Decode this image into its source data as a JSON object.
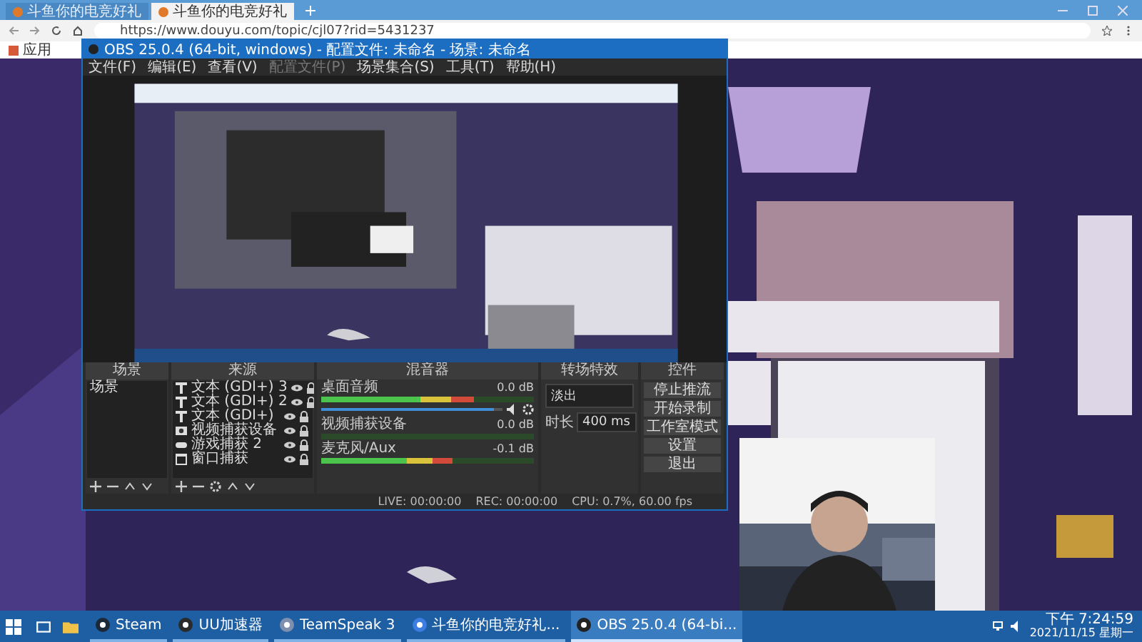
{
  "browser": {
    "tabs": [
      {
        "title": "斗鱼你的电竞好礼",
        "selected": false
      },
      {
        "title": "斗鱼你的电竞好礼",
        "selected": true
      }
    ],
    "url": "https://www.douyu.com/topic/cjl07?rid=5431237",
    "bookmarks": [
      "应用"
    ]
  },
  "obs": {
    "title": "OBS 25.0.4 (64-bit, windows) - 配置文件: 未命名 - 场景: 未命名",
    "menu": [
      {
        "label": "文件(F)",
        "disabled": false
      },
      {
        "label": "编辑(E)",
        "disabled": false
      },
      {
        "label": "查看(V)",
        "disabled": false
      },
      {
        "label": "配置文件(P)",
        "disabled": true
      },
      {
        "label": "场景集合(S)",
        "disabled": false
      },
      {
        "label": "工具(T)",
        "disabled": false
      },
      {
        "label": "帮助(H)",
        "disabled": false
      }
    ],
    "scenes": {
      "title": "场景",
      "items": [
        "场景"
      ]
    },
    "sources": {
      "title": "来源",
      "items": [
        {
          "label": "文本 (GDI+) 3",
          "kind": "text"
        },
        {
          "label": "文本 (GDI+) 2",
          "kind": "text"
        },
        {
          "label": "文本 (GDI+)",
          "kind": "text"
        },
        {
          "label": "视频捕获设备",
          "kind": "camera"
        },
        {
          "label": "游戏捕获 2",
          "kind": "game"
        },
        {
          "label": "窗口捕获",
          "kind": "window"
        }
      ]
    },
    "mixer": {
      "title": "混音器",
      "channels": [
        {
          "name": "桌面音频",
          "reading": "0.0 dB",
          "level": 0.72,
          "volume": {
            "level": 0.95
          }
        },
        {
          "name": "视频捕获设备",
          "reading": "0.0 dB",
          "level": 0.0
        },
        {
          "name": "麦克风/Aux",
          "reading": "-0.1 dB",
          "level": 0.62
        }
      ]
    },
    "transitions": {
      "title": "转场特效",
      "transition": "淡出",
      "duration_label": "时长",
      "duration": "400 ms"
    },
    "controls": {
      "title": "控件",
      "buttons": [
        "停止推流",
        "开始录制",
        "工作室模式",
        "设置",
        "退出"
      ]
    },
    "status": {
      "live": "LIVE: 00:00:00",
      "rec": "REC: 00:00:00",
      "cpu": "CPU: 0.7%, 60.00 fps"
    }
  },
  "taskbar": {
    "items": [
      {
        "label": "Steam",
        "kind": "steam",
        "selected": false
      },
      {
        "label": "UU加速器",
        "kind": "uu",
        "selected": false
      },
      {
        "label": "TeamSpeak 3",
        "kind": "teamspeak",
        "selected": false
      },
      {
        "label": "斗鱼你的电竞好礼...",
        "kind": "browser",
        "selected": false
      },
      {
        "label": "OBS 25.0.4 (64-bi...",
        "kind": "obs",
        "selected": true
      }
    ],
    "time": "下午 7:24:59",
    "date": "2021/11/15 星期一"
  }
}
